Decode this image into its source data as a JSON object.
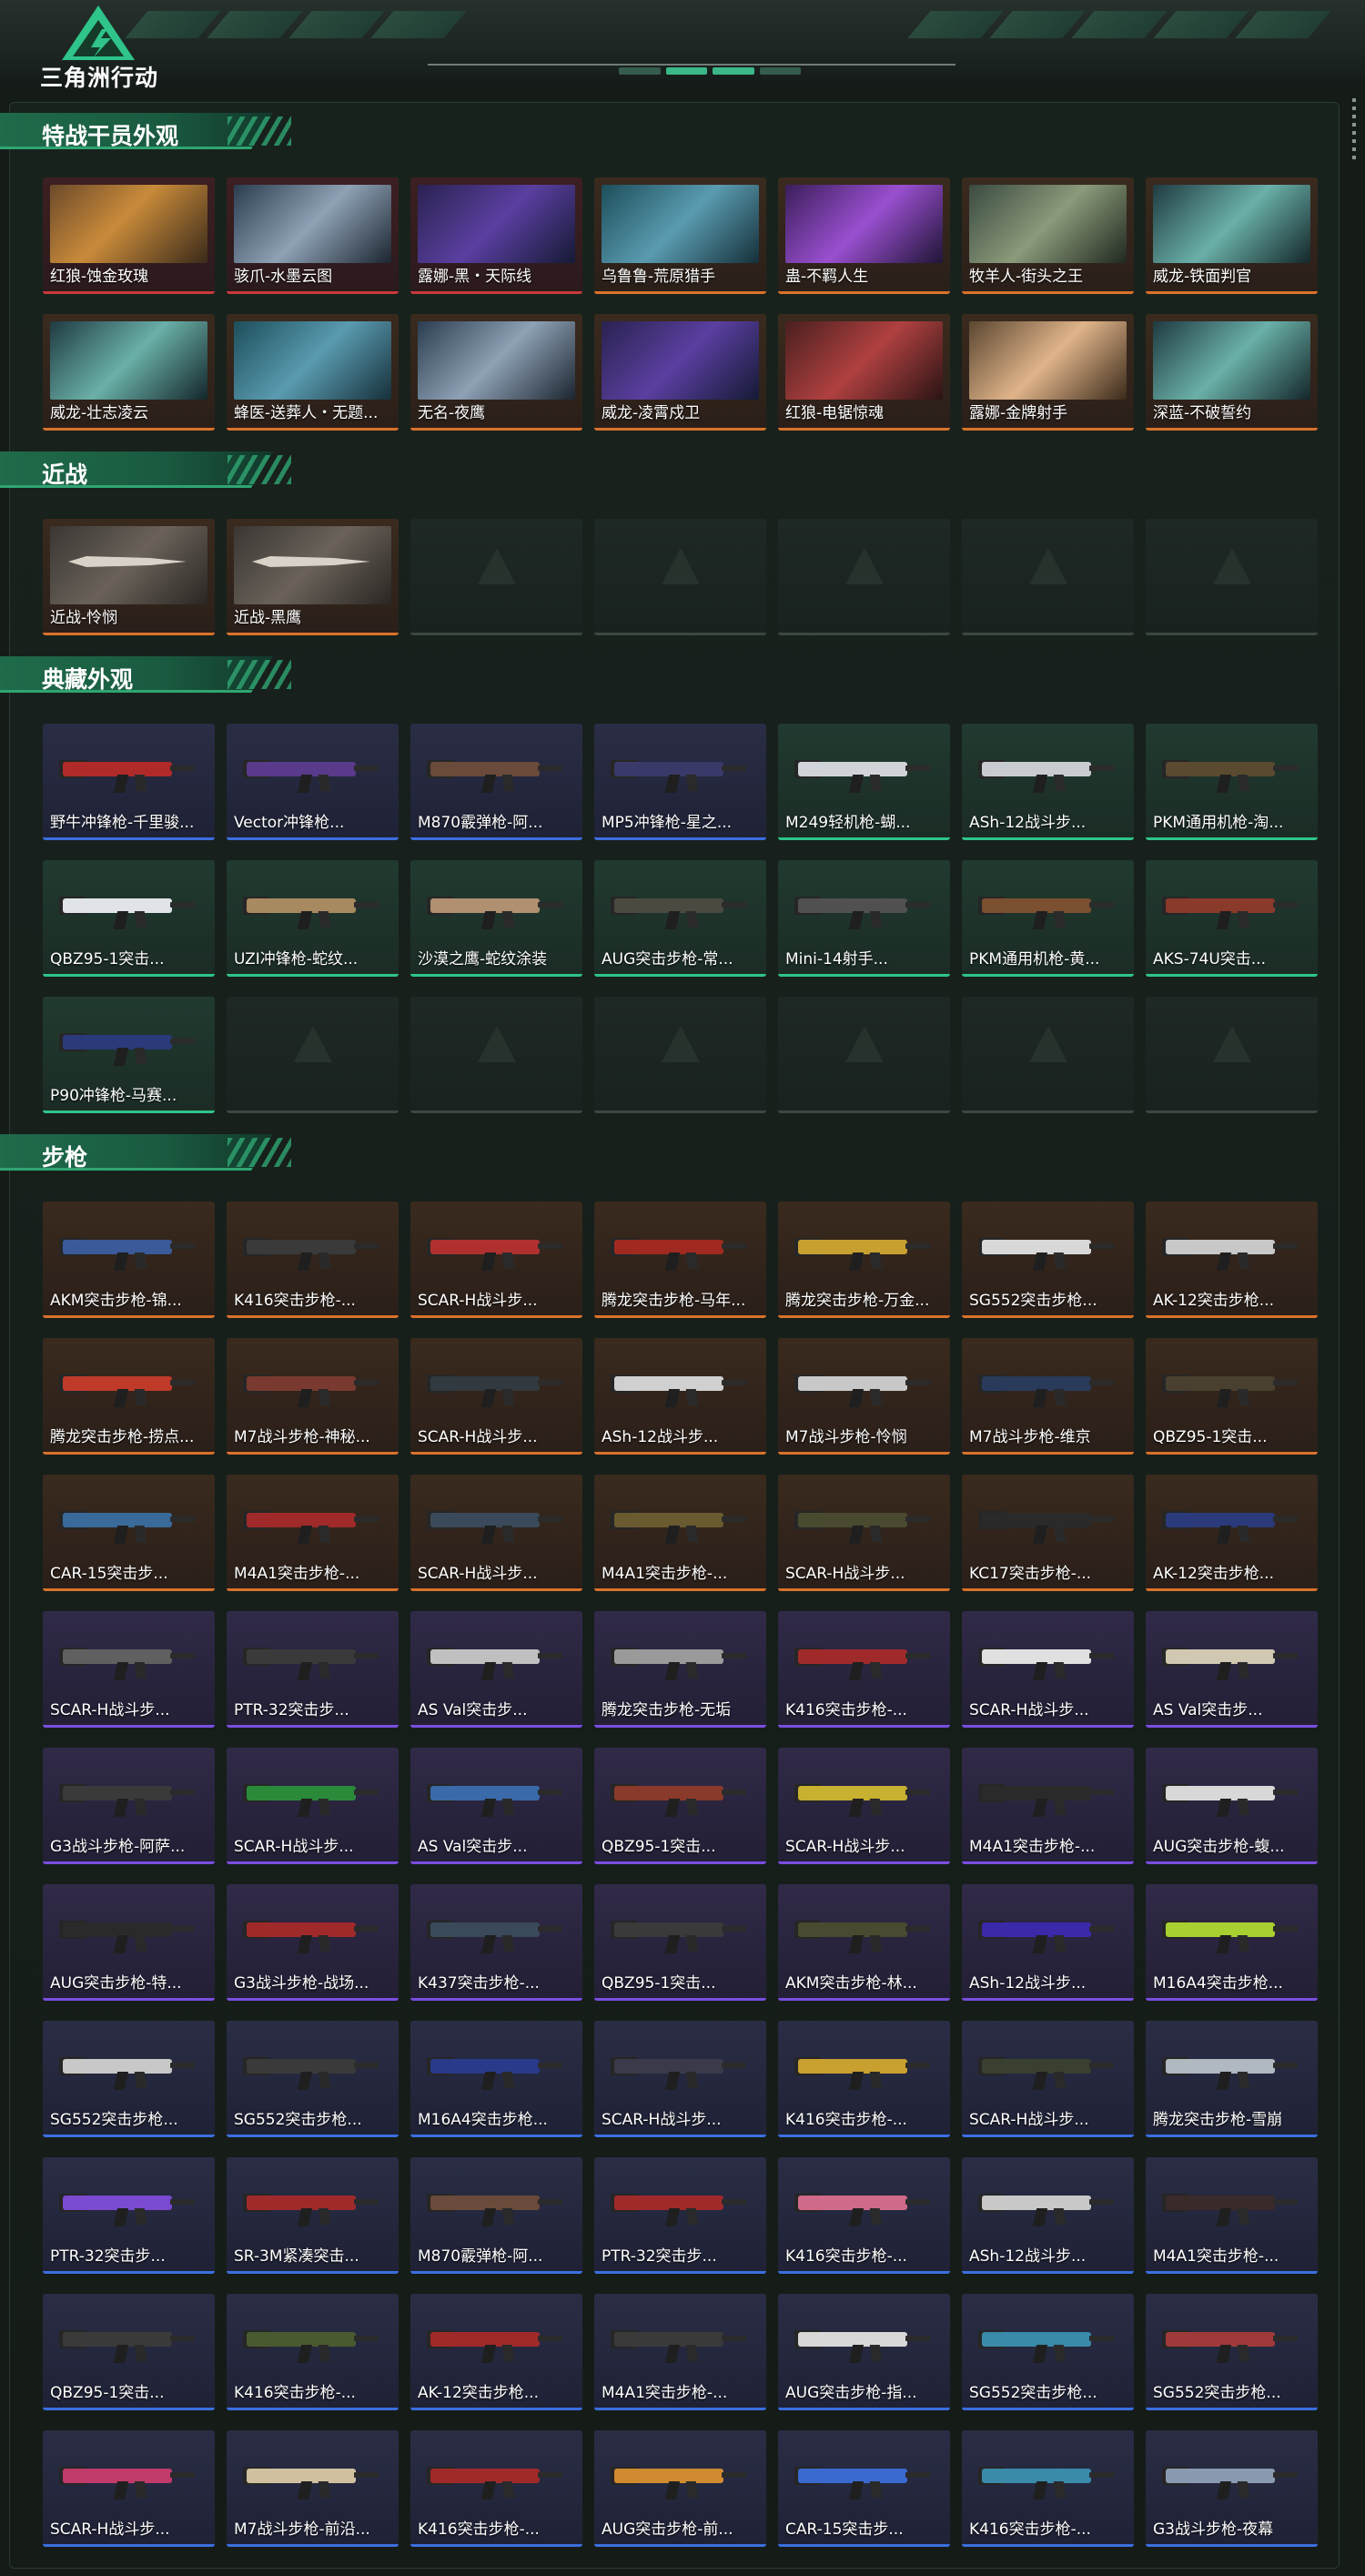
{
  "app": {
    "logo_text": "三角洲行动"
  },
  "colors": {
    "accent": "#2fa572",
    "orange": "#d9722c",
    "blue": "#3b6fe0",
    "purple": "#7a4ee0",
    "green": "#2fc48a",
    "red": "#c9393b"
  },
  "sections": [
    {
      "title": "特战干员外观",
      "items": [
        {
          "label": "红狼-蚀金玫瑰",
          "rarity": "red",
          "art": "p1"
        },
        {
          "label": "骇爪-水墨云图",
          "rarity": "red",
          "art": "p2"
        },
        {
          "label": "露娜-黑・天际线",
          "rarity": "red",
          "art": "p3"
        },
        {
          "label": "乌鲁鲁-荒原猎手",
          "rarity": "orange",
          "art": "p4"
        },
        {
          "label": "蛊-不羁人生",
          "rarity": "orange",
          "art": "p5"
        },
        {
          "label": "牧羊人-街头之王",
          "rarity": "orange",
          "art": "p6"
        },
        {
          "label": "威龙-铁面判官",
          "rarity": "orange",
          "art": "p7"
        },
        {
          "label": "威龙-壮志凌云",
          "rarity": "orange",
          "art": "p7"
        },
        {
          "label": "蜂医-送葬人・无题...",
          "rarity": "orange",
          "art": "p4"
        },
        {
          "label": "无名-夜鹰",
          "rarity": "orange",
          "art": "p2"
        },
        {
          "label": "威龙-凌霄戍卫",
          "rarity": "orange",
          "art": "p3"
        },
        {
          "label": "红狼-电锯惊魂",
          "rarity": "orange",
          "art": "p8"
        },
        {
          "label": "露娜-金牌射手",
          "rarity": "orange",
          "art": "p9"
        },
        {
          "label": "深蓝-不破誓约",
          "rarity": "orange",
          "art": "p7"
        }
      ]
    },
    {
      "title": "近战",
      "items": [
        {
          "label": "近战-怜悯",
          "rarity": "orange",
          "art": "knife"
        },
        {
          "label": "近战-黑鹰",
          "rarity": "orange",
          "art": "knife"
        },
        {
          "label": "",
          "rarity": "empty"
        },
        {
          "label": "",
          "rarity": "empty"
        },
        {
          "label": "",
          "rarity": "empty"
        },
        {
          "label": "",
          "rarity": "empty"
        },
        {
          "label": "",
          "rarity": "empty"
        }
      ]
    },
    {
      "title": "典藏外观",
      "items": [
        {
          "label": "野牛冲锋枪-千里骏...",
          "rarity": "blue",
          "gun": "#b02a2a"
        },
        {
          "label": "Vector冲锋枪...",
          "rarity": "blue",
          "gun": "#5a3a8a"
        },
        {
          "label": "M870霰弹枪-阿...",
          "rarity": "blue",
          "gun": "#6a4a3a"
        },
        {
          "label": "MP5冲锋枪-星之...",
          "rarity": "blue",
          "gun": "#3a3a6a"
        },
        {
          "label": "M249轻机枪-蝴...",
          "rarity": "green",
          "gun": "#d0d4d8"
        },
        {
          "label": "ASh-12战斗步...",
          "rarity": "green",
          "gun": "#c8ccd0"
        },
        {
          "label": "PKM通用机枪-淘...",
          "rarity": "green",
          "gun": "#5a4a30"
        },
        {
          "label": "QBZ95-1突击...",
          "rarity": "green",
          "gun": "#e0e4e8"
        },
        {
          "label": "UZI冲锋枪-蛇纹...",
          "rarity": "green",
          "gun": "#a88a60"
        },
        {
          "label": "沙漠之鹰-蛇纹涂装",
          "rarity": "green",
          "gun": "#b09070"
        },
        {
          "label": "AUG突击步枪-常...",
          "rarity": "green",
          "gun": "#4a4a40"
        },
        {
          "label": "Mini-14射手...",
          "rarity": "green",
          "gun": "#505050"
        },
        {
          "label": "PKM通用机枪-黄...",
          "rarity": "green",
          "gun": "#7a5030"
        },
        {
          "label": "AKS-74U突击...",
          "rarity": "green",
          "gun": "#8a3a2a"
        },
        {
          "label": "P90冲锋枪-马赛...",
          "rarity": "green",
          "gun": "#2a3a7a"
        },
        {
          "label": "",
          "rarity": "empty"
        },
        {
          "label": "",
          "rarity": "empty"
        },
        {
          "label": "",
          "rarity": "empty"
        },
        {
          "label": "",
          "rarity": "empty"
        },
        {
          "label": "",
          "rarity": "empty"
        },
        {
          "label": "",
          "rarity": "empty"
        }
      ]
    },
    {
      "title": "步枪",
      "items": [
        {
          "label": "AKM突击步枪-锦...",
          "rarity": "orange",
          "gun": "#3a5a9a"
        },
        {
          "label": "K416突击步枪-...",
          "rarity": "orange",
          "gun": "#3a3a3a"
        },
        {
          "label": "SCAR-H战斗步...",
          "rarity": "orange",
          "gun": "#b03030"
        },
        {
          "label": "腾龙突击步枪-马年...",
          "rarity": "orange",
          "gun": "#a02a20"
        },
        {
          "label": "腾龙突击步枪-万金...",
          "rarity": "orange",
          "gun": "#c8a030"
        },
        {
          "label": "SG552突击步枪...",
          "rarity": "orange",
          "gun": "#d8d8d8"
        },
        {
          "label": "AK-12突击步枪...",
          "rarity": "orange",
          "gun": "#c8c8c8"
        },
        {
          "label": "腾龙突击步枪-捞点...",
          "rarity": "orange",
          "gun": "#c03a2a"
        },
        {
          "label": "M7战斗步枪-神秘...",
          "rarity": "orange",
          "gun": "#7a3a30"
        },
        {
          "label": "SCAR-H战斗步...",
          "rarity": "orange",
          "gun": "#303a40"
        },
        {
          "label": "ASh-12战斗步...",
          "rarity": "orange",
          "gun": "#d0d0d0"
        },
        {
          "label": "M7战斗步枪-怜悯",
          "rarity": "orange",
          "gun": "#c8c8c8"
        },
        {
          "label": "M7战斗步枪-维京",
          "rarity": "orange",
          "gun": "#2a3a5a"
        },
        {
          "label": "QBZ95-1突击...",
          "rarity": "orange",
          "gun": "#4a4030"
        },
        {
          "label": "CAR-15突击步...",
          "rarity": "orange",
          "gun": "#3a6a9a"
        },
        {
          "label": "M4A1突击步枪-...",
          "rarity": "orange",
          "gun": "#a02a2a"
        },
        {
          "label": "SCAR-H战斗步...",
          "rarity": "orange",
          "gun": "#3a4a5a"
        },
        {
          "label": "M4A1突击步枪-...",
          "rarity": "orange",
          "gun": "#6a5a30"
        },
        {
          "label": "SCAR-H战斗步...",
          "rarity": "orange",
          "gun": "#4a4a30"
        },
        {
          "label": "KC17突击步枪-...",
          "rarity": "orange",
          "gun": "#2a2a2a"
        },
        {
          "label": "AK-12突击步枪...",
          "rarity": "orange",
          "gun": "#2a3a7a"
        },
        {
          "label": "SCAR-H战斗步...",
          "rarity": "purple",
          "gun": "#606060"
        },
        {
          "label": "PTR-32突击步...",
          "rarity": "purple",
          "gun": "#3a3a3a"
        },
        {
          "label": "AS Val突击步...",
          "rarity": "purple",
          "gun": "#c0c0c0"
        },
        {
          "label": "腾龙突击步枪-无垢",
          "rarity": "purple",
          "gun": "#9a9a9a"
        },
        {
          "label": "K416突击步枪-...",
          "rarity": "purple",
          "gun": "#a02a2a"
        },
        {
          "label": "SCAR-H战斗步...",
          "rarity": "purple",
          "gun": "#e0e0e0"
        },
        {
          "label": "AS Val突击步...",
          "rarity": "purple",
          "gun": "#d0c8b0"
        },
        {
          "label": "G3战斗步枪-阿萨...",
          "rarity": "purple",
          "gun": "#3a3a3a"
        },
        {
          "label": "SCAR-H战斗步...",
          "rarity": "purple",
          "gun": "#2a8a3a"
        },
        {
          "label": "AS Val突击步...",
          "rarity": "purple",
          "gun": "#3a6aaa"
        },
        {
          "label": "QBZ95-1突击...",
          "rarity": "purple",
          "gun": "#8a3a2a"
        },
        {
          "label": "SCAR-H战斗步...",
          "rarity": "purple",
          "gun": "#c8b030"
        },
        {
          "label": "M4A1突击步枪-...",
          "rarity": "purple",
          "gun": "#2a2a2a"
        },
        {
          "label": "AUG突击步枪-蝮...",
          "rarity": "purple",
          "gun": "#d8d8d8"
        },
        {
          "label": "AUG突击步枪-特...",
          "rarity": "purple",
          "gun": "#2a2a2a"
        },
        {
          "label": "G3战斗步枪-战场...",
          "rarity": "purple",
          "gun": "#a02a2a"
        },
        {
          "label": "K437突击步枪-...",
          "rarity": "purple",
          "gun": "#3a4a5a"
        },
        {
          "label": "QBZ95-1突击...",
          "rarity": "purple",
          "gun": "#3a3a3a"
        },
        {
          "label": "AKM突击步枪-林...",
          "rarity": "purple",
          "gun": "#4a4a30"
        },
        {
          "label": "ASh-12战斗步...",
          "rarity": "purple",
          "gun": "#3a2aaa"
        },
        {
          "label": "M16A4突击步枪...",
          "rarity": "purple",
          "gun": "#a8d030"
        },
        {
          "label": "SG552突击步枪...",
          "rarity": "blue",
          "gun": "#c8c8c8"
        },
        {
          "label": "SG552突击步枪...",
          "rarity": "blue",
          "gun": "#3a3a3a"
        },
        {
          "label": "M16A4突击步枪...",
          "rarity": "blue",
          "gun": "#2a3a8a"
        },
        {
          "label": "SCAR-H战斗步...",
          "rarity": "blue",
          "gun": "#3a3a4a"
        },
        {
          "label": "K416突击步枪-...",
          "rarity": "blue",
          "gun": "#c8a030"
        },
        {
          "label": "SCAR-H战斗步...",
          "rarity": "blue",
          "gun": "#3a4030"
        },
        {
          "label": "腾龙突击步枪-雪崩",
          "rarity": "blue",
          "gun": "#b0b8c0"
        },
        {
          "label": "PTR-32突击步...",
          "rarity": "blue",
          "gun": "#7a4ad0"
        },
        {
          "label": "SR-3M紧凑突击...",
          "rarity": "blue",
          "gun": "#a02a2a"
        },
        {
          "label": "M870霰弹枪-阿...",
          "rarity": "blue",
          "gun": "#6a4a3a"
        },
        {
          "label": "PTR-32突击步...",
          "rarity": "blue",
          "gun": "#a02a2a"
        },
        {
          "label": "K416突击步枪-...",
          "rarity": "blue",
          "gun": "#d06a8a"
        },
        {
          "label": "ASh-12战斗步...",
          "rarity": "blue",
          "gun": "#c8c8c8"
        },
        {
          "label": "M4A1突击步枪-...",
          "rarity": "blue",
          "gun": "#3a2a2a"
        },
        {
          "label": "QBZ95-1突击...",
          "rarity": "blue",
          "gun": "#3a3a3a"
        },
        {
          "label": "K416突击步枪-...",
          "rarity": "blue",
          "gun": "#4a5a30"
        },
        {
          "label": "AK-12突击步枪...",
          "rarity": "blue",
          "gun": "#a02a2a"
        },
        {
          "label": "M4A1突击步枪-...",
          "rarity": "blue",
          "gun": "#3a3a3a"
        },
        {
          "label": "AUG突击步枪-指...",
          "rarity": "blue",
          "gun": "#d8d8d8"
        },
        {
          "label": "SG552突击步枪...",
          "rarity": "blue",
          "gun": "#3a8aaa"
        },
        {
          "label": "SG552突击步枪...",
          "rarity": "blue",
          "gun": "#a03a3a"
        },
        {
          "label": "SCAR-H战斗步...",
          "rarity": "blue",
          "gun": "#c03a6a"
        },
        {
          "label": "M7战斗步枪-前沿...",
          "rarity": "blue",
          "gun": "#d0c0a0"
        },
        {
          "label": "K416突击步枪-...",
          "rarity": "blue",
          "gun": "#a02a2a"
        },
        {
          "label": "AUG突击步枪-前...",
          "rarity": "blue",
          "gun": "#d08a30"
        },
        {
          "label": "CAR-15突击步...",
          "rarity": "blue",
          "gun": "#3a6ad0"
        },
        {
          "label": "K416突击步枪-...",
          "rarity": "blue",
          "gun": "#3a8aaa"
        },
        {
          "label": "G3战斗步枪-夜幕",
          "rarity": "blue",
          "gun": "#8a9ab0"
        }
      ]
    }
  ]
}
